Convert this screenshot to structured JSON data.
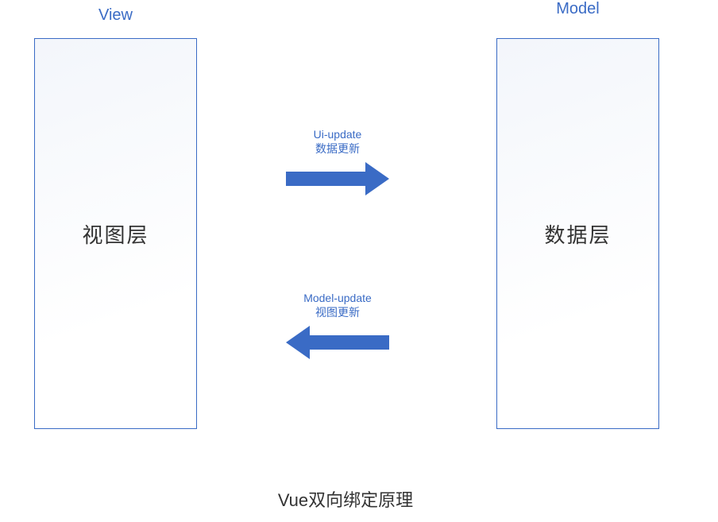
{
  "headings": {
    "left": "View",
    "right": "Model"
  },
  "panels": {
    "left_label": "视图层",
    "right_label": "数据层"
  },
  "arrows": {
    "top": {
      "line1": "Ui-update",
      "line2": "数据更新"
    },
    "bottom": {
      "line1": "Model-update",
      "line2": "视图更新"
    }
  },
  "footer": "Vue双向绑定原理",
  "colors": {
    "accent": "#3a6bc5",
    "arrow_fill": "#3a6bc5"
  }
}
